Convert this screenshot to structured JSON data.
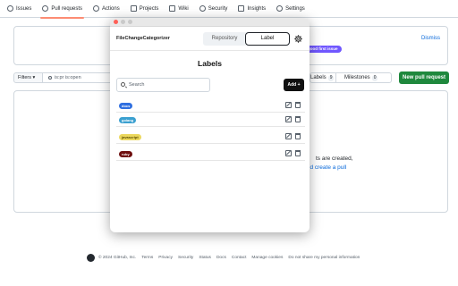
{
  "repo_nav": {
    "tabs": [
      {
        "label": "Issues",
        "icon": "issue-icon",
        "active": false
      },
      {
        "label": "Pull requests",
        "icon": "pull-request-icon",
        "active": true
      },
      {
        "label": "Actions",
        "icon": "play-icon",
        "active": false
      },
      {
        "label": "Projects",
        "icon": "table-icon",
        "active": false
      },
      {
        "label": "Wiki",
        "icon": "book-icon",
        "active": false
      },
      {
        "label": "Security",
        "icon": "shield-icon",
        "active": false
      },
      {
        "label": "Insights",
        "icon": "graph-icon",
        "active": false
      },
      {
        "label": "Settings",
        "icon": "gear-icon",
        "active": false
      }
    ]
  },
  "banner": {
    "good_first_issue": "good first issue",
    "dismiss": "Dismiss"
  },
  "toolbar": {
    "filters_label": "Filters",
    "filter_value": "is:pr is:open",
    "labels_label": "Labels",
    "labels_count": "9",
    "milestones_label": "Milestones",
    "milestones_count": "0",
    "new_pr_label": "New pull request"
  },
  "empty_state": {
    "line1": "ts are created,",
    "line2": "id create a pull"
  },
  "footer": {
    "copyright": "© 2024 GitHub, Inc.",
    "links": [
      "Terms",
      "Privacy",
      "Security",
      "Status",
      "Docs",
      "Contact",
      "Manage cookies",
      "Do not share my personal information"
    ]
  },
  "popup": {
    "app_name": "FileChangeCategorizer",
    "tabs": {
      "repository": "Repository",
      "label": "Label",
      "active": "label"
    },
    "title": "Labels",
    "search_placeholder": "Search",
    "add_button": "Add +",
    "labels": [
      {
        "name": "docs",
        "color": "#2f6fe0",
        "text_color": "#ffffff"
      },
      {
        "name": "golang",
        "color": "#3ba0d0",
        "text_color": "#ffffff"
      },
      {
        "name": "javascript",
        "color": "#ecd85e",
        "text_color": "#5a4c00"
      },
      {
        "name": "ruby",
        "color": "#6e0f0f",
        "text_color": "#ffffff"
      }
    ]
  },
  "colors": {
    "accent_green": "#1f883d",
    "link_blue": "#0969da",
    "active_tab_underline": "#fd8c73"
  }
}
